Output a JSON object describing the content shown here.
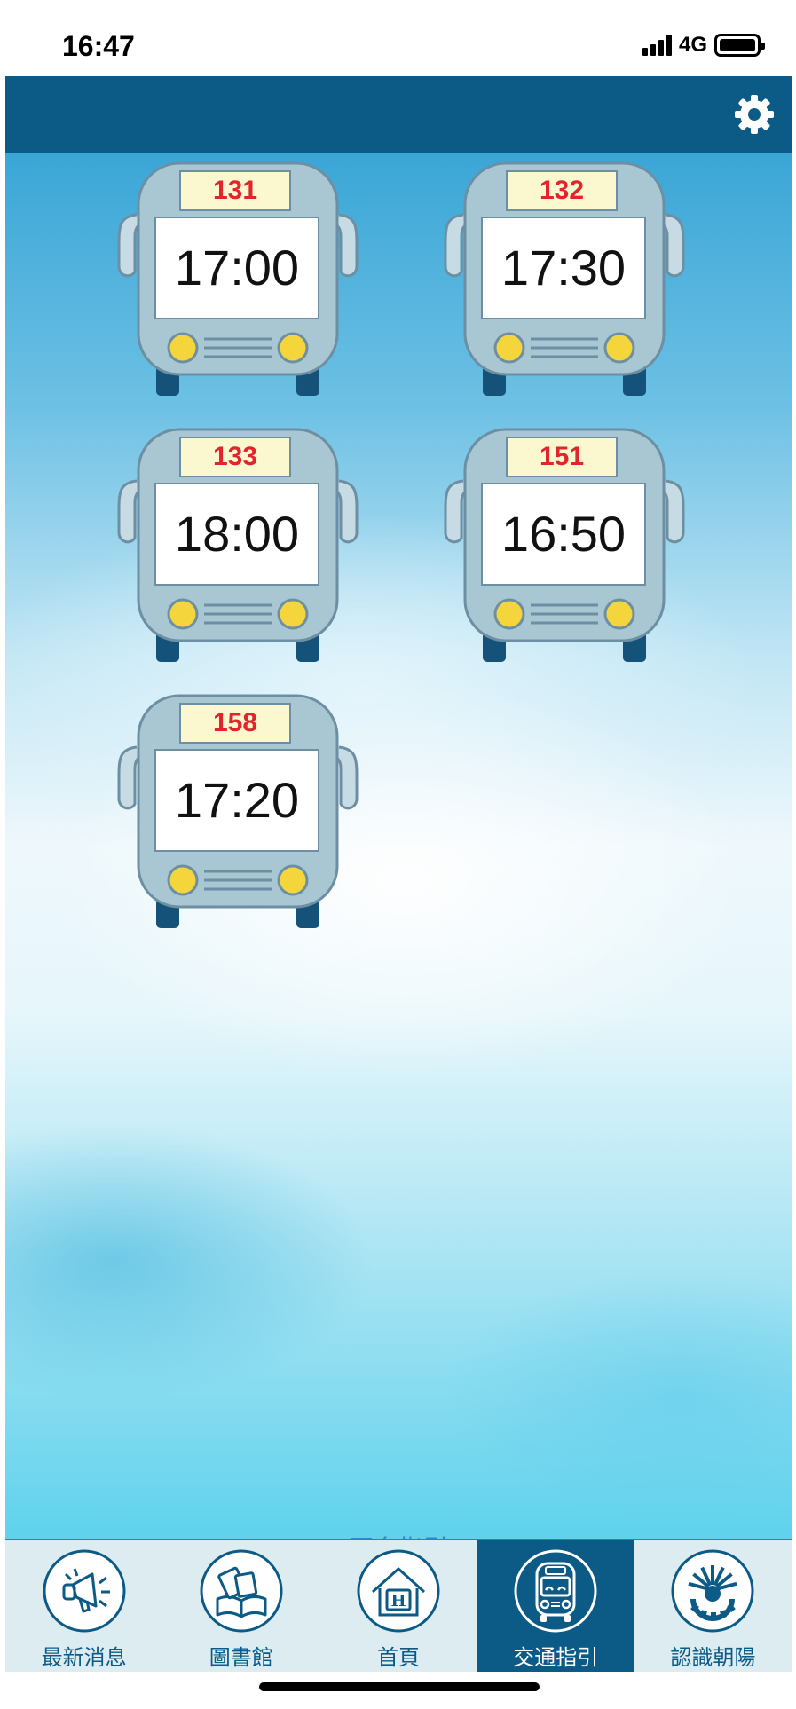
{
  "status_bar": {
    "time": "16:47",
    "network": "4G"
  },
  "buses": [
    {
      "route": "131",
      "time": "17:00"
    },
    {
      "route": "132",
      "time": "17:30"
    },
    {
      "route": "133",
      "time": "18:00"
    },
    {
      "route": "151",
      "time": "16:50"
    },
    {
      "route": "158",
      "time": "17:20"
    }
  ],
  "more_link": "更多指引",
  "tabs": [
    {
      "label": "最新消息",
      "icon": "megaphone-icon"
    },
    {
      "label": "圖書館",
      "icon": "books-icon"
    },
    {
      "label": "首頁",
      "icon": "home-icon"
    },
    {
      "label": "交通指引",
      "icon": "bus-icon",
      "active": true
    },
    {
      "label": "認識朝陽",
      "icon": "sun-gear-logo-icon"
    }
  ],
  "colors": {
    "header": "#0c5a86",
    "route_text": "#e0252c",
    "link": "#2b8ad6",
    "tabbar_bg": "#dcecf1"
  }
}
